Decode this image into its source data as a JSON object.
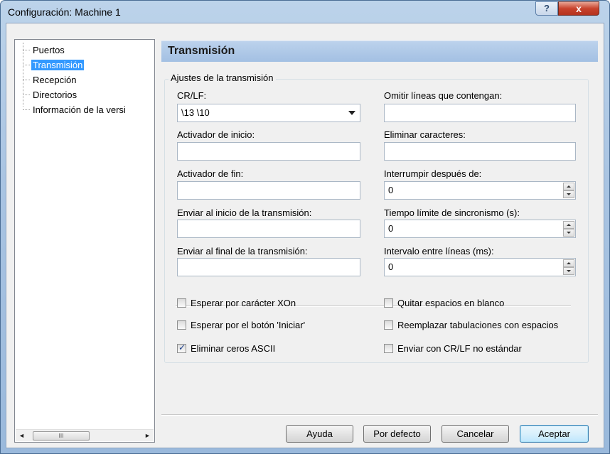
{
  "window": {
    "title": "Configuración: Machine 1",
    "help_label": "?",
    "close_label": "x"
  },
  "tree": {
    "items": [
      {
        "label": "Puertos",
        "selected": false
      },
      {
        "label": "Transmisión",
        "selected": true
      },
      {
        "label": "Recepción",
        "selected": false
      },
      {
        "label": "Directorios",
        "selected": false
      },
      {
        "label": "Información de la versi",
        "selected": false
      }
    ],
    "scroll_left": "◄",
    "scroll_right": "►",
    "scroll_thumb": "III"
  },
  "panel": {
    "heading": "Transmisión",
    "group_title": "Ajustes de la transmisión",
    "left_fields": [
      {
        "label": "CR/LF:",
        "value": "\\13 \\10"
      },
      {
        "label": "Activador de inicio:",
        "value": ""
      },
      {
        "label": "Activador de fin:",
        "value": ""
      },
      {
        "label": "Enviar al inicio de la transmisión:",
        "value": ""
      },
      {
        "label": "Enviar al final de la transmisión:",
        "value": ""
      }
    ],
    "right_fields": [
      {
        "label": "Omitir líneas que contengan:",
        "value": ""
      },
      {
        "label": "Eliminar caracteres:",
        "value": ""
      },
      {
        "label": "Interrumpir después de:",
        "value": "0"
      },
      {
        "label": "Tiempo límite de sincronismo (s):",
        "value": "0"
      },
      {
        "label": "Intervalo entre líneas (ms):",
        "value": "0"
      }
    ],
    "checkboxes_left": [
      {
        "label": "Esperar por carácter XOn",
        "checked": false
      },
      {
        "label": "Esperar por el botón 'Iniciar'",
        "checked": false
      },
      {
        "label": "Eliminar ceros ASCII",
        "checked": true
      }
    ],
    "checkboxes_right": [
      {
        "label": "Quitar espacios en blanco",
        "checked": false
      },
      {
        "label": "Reemplazar tabulaciones con espacios",
        "checked": false
      },
      {
        "label": "Enviar con CR/LF no estándar",
        "checked": false
      }
    ]
  },
  "buttons": {
    "help": "Ayuda",
    "defaults": "Por defecto",
    "cancel": "Cancelar",
    "accept": "Aceptar"
  }
}
